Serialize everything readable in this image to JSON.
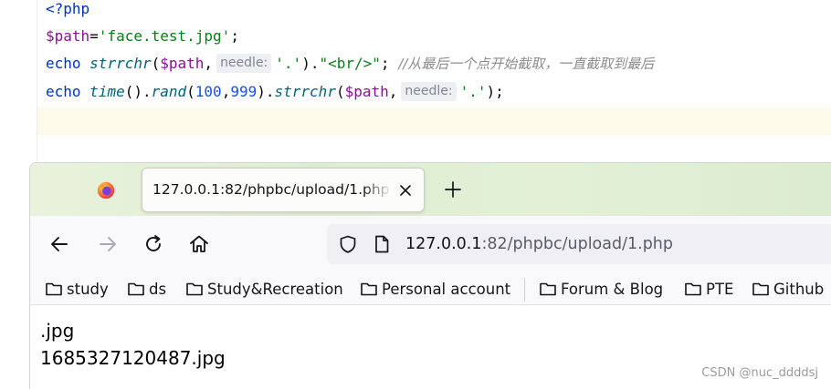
{
  "editor": {
    "line1": {
      "tag": "<?php"
    },
    "line2": {
      "var": "$path",
      "eq": "=",
      "str": "'face.test.jpg'",
      "semi": ";"
    },
    "line3": {
      "kw": "echo",
      "fn": "strrchr",
      "open": "(",
      "var": "$path",
      "comma": ",",
      "hint": "needle:",
      "arg": "'.'",
      "close": ")",
      "dot": ".",
      "str": "\"<br/>\"",
      "semi": ";",
      "comment": "//从最后一个点开始截取，一直截取到最后"
    },
    "line4": {
      "kw": "echo",
      "fn_time": "time",
      "parens": "()",
      "dot1": ".",
      "fn_rand": "rand",
      "open1": "(",
      "n1": "100",
      "comma1": ",",
      "n2": "999",
      "close1": ")",
      "dot2": ".",
      "fn_strrchr": "strrchr",
      "open2": "(",
      "var": "$path",
      "comma2": ",",
      "hint": "needle:",
      "arg": "'.'",
      "close2": ")",
      "semi": ";"
    }
  },
  "browser": {
    "tab": {
      "title": "127.0.0.1:82/phpbc/upload/1.php"
    },
    "url": {
      "host": "127.0.0.1",
      "rest": ":82/phpbc/upload/1.php"
    },
    "bookmarks": [
      {
        "label": "study"
      },
      {
        "label": "ds"
      },
      {
        "label": "Study&Recreation"
      },
      {
        "label": "Personal account"
      },
      {
        "label": "Forum & Blog"
      },
      {
        "label": "PTE"
      },
      {
        "label": "Github"
      }
    ],
    "output": {
      "line1": ".jpg",
      "line2": "1685327120487.jpg"
    }
  },
  "watermark": "CSDN @nuc_ddddsj",
  "colors": {
    "keyword": "#0033b3",
    "variable": "#871094",
    "function": "#00627a",
    "string": "#067d17",
    "number": "#1750eb",
    "comment": "#8c8c8c",
    "tabstrip": "#e3f0d6",
    "toolbar": "#f9f9fb",
    "urlbar": "#f0f0f4"
  },
  "icons": {
    "browser_logo": "firefox-icon",
    "tab_close": "close-icon",
    "new_tab": "plus-icon",
    "back": "arrow-left-icon",
    "forward": "arrow-right-icon",
    "reload": "reload-icon",
    "home": "home-icon",
    "tracking": "shield-icon",
    "site": "page-icon",
    "bookmark": "folder-icon"
  }
}
